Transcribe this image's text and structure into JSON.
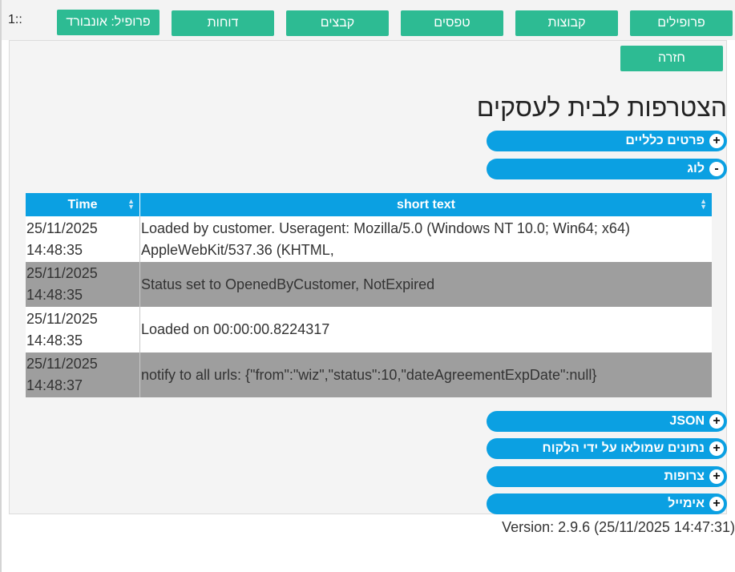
{
  "corner_label": "1::",
  "nav": {
    "onboard": "פרופיל: אונבורד",
    "reports": "דוחות",
    "files": "קבצים",
    "forms": "טפסים",
    "groups": "קבוצות",
    "profiles": "פרופילים"
  },
  "back_label": "חזרה",
  "page_title": "הצטרפות לבית לעסקים",
  "sections": {
    "general": {
      "label": "פרטים כלליים",
      "icon": "+"
    },
    "log": {
      "label": "לוג",
      "icon": "-"
    },
    "json": {
      "label": "JSON",
      "icon": "+"
    },
    "customer_data": {
      "label": "נתונים שמולאו על ידי הלקוח",
      "icon": "+"
    },
    "attachments": {
      "label": "צרופות",
      "icon": "+"
    },
    "email": {
      "label": "אימייל",
      "icon": "+"
    }
  },
  "log_table": {
    "headers": {
      "time": "Time",
      "short_text": "short text"
    },
    "rows": [
      {
        "date": "25/11/2025",
        "time": "14:48:35",
        "text1": "Loaded by customer. Useragent: Mozilla/5.0 (Windows NT 10.0; Win64; x64)",
        "text2": "AppleWebKit/537.36 (KHTML,"
      },
      {
        "date": "25/11/2025",
        "time": "14:48:35",
        "text1": "Status set to OpenedByCustomer, NotExpired"
      },
      {
        "date": "25/11/2025",
        "time": "14:48:35",
        "text1": "Loaded on 00:00:00.8224317"
      },
      {
        "date": "25/11/2025",
        "time": "14:48:37",
        "text1": "notify to all urls: {\"from\":\"wiz\",\"status\":10,\"dateAgreementExpDate\":null}"
      }
    ]
  },
  "version_text": "Version: 2.9.6 (25/11/2025 14:47:31)",
  "colors": {
    "nav_green": "#2dbb93",
    "accordion_blue": "#0ba0e2",
    "row_gray": "#9e9e9e"
  }
}
